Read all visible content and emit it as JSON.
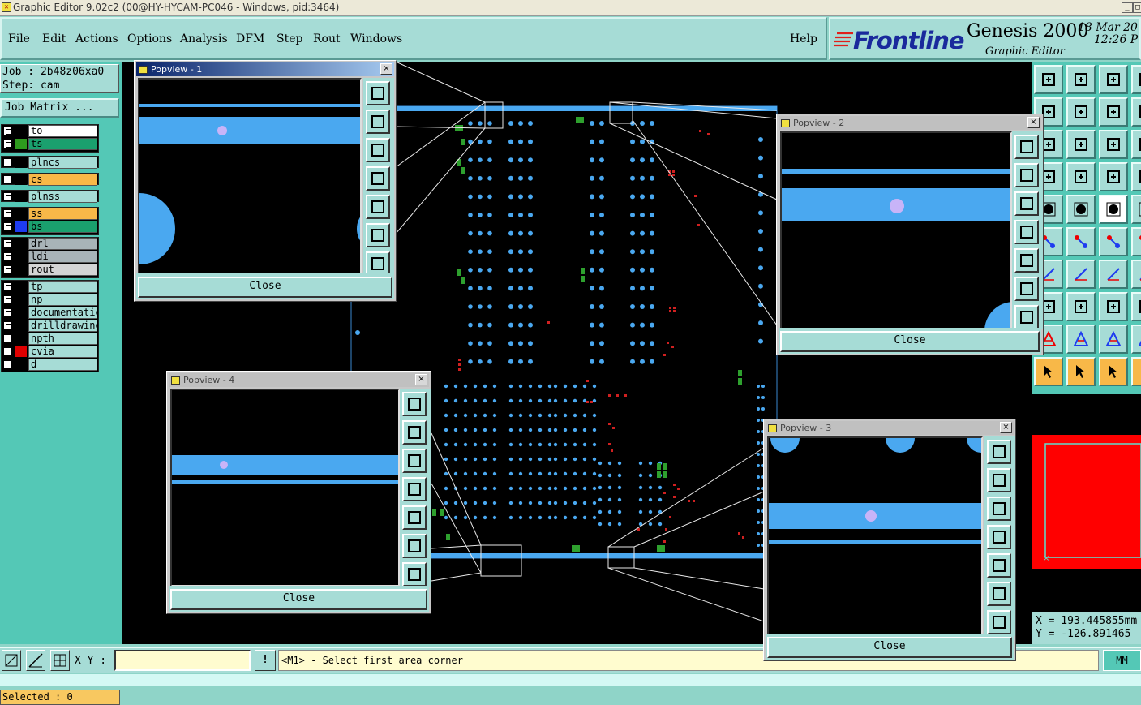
{
  "window": {
    "title": "Graphic Editor 9.02c2 (00@HY-HYCAM-PC046 - Windows, pid:3464)",
    "min": "_",
    "max": "□"
  },
  "menu": {
    "items": [
      "File",
      "Edit",
      "Actions",
      "Options",
      "Analysis",
      "DFM",
      "Step",
      "Rout",
      "Windows"
    ],
    "help": "Help"
  },
  "brand": {
    "logo": "Frontline",
    "product": "Genesis 2000",
    "subtitle": "Graphic Editor",
    "date": "18 Mar 20",
    "time": "12:26 P"
  },
  "job": {
    "job_line": "Job : 2b48z06xa0",
    "step_line": "Step: cam",
    "matrix_button": "Job Matrix ..."
  },
  "layers": [
    {
      "name": "to",
      "color": "#000000",
      "bg": "#ffffff"
    },
    {
      "name": "ts",
      "color": "#2e9a1e",
      "bg": "#1aa06e"
    },
    {
      "name": "plncs",
      "color": "#000000",
      "bg": "#a6dcd6"
    },
    {
      "name": "cs",
      "color": "#000000",
      "bg": "#f8b848"
    },
    {
      "name": "plnss",
      "color": "#000000",
      "bg": "#a6dcd6"
    },
    {
      "name": "ss",
      "color": "#000000",
      "bg": "#f8b848"
    },
    {
      "name": "bs",
      "color": "#1e3cf0",
      "bg": "#1aa06e"
    },
    {
      "name": "drl",
      "color": "#000000",
      "bg": "#a8b4b8"
    },
    {
      "name": "ldi",
      "color": "#000000",
      "bg": "#a8b4b8"
    },
    {
      "name": "rout",
      "color": "#000000",
      "bg": "#d4d4d4"
    },
    {
      "name": "tp",
      "color": "#000000",
      "bg": "#a6dcd6"
    },
    {
      "name": "np",
      "color": "#000000",
      "bg": "#a6dcd6"
    },
    {
      "name": "documentation",
      "color": "#000000",
      "bg": "#a6dcd6"
    },
    {
      "name": "drilldrawing",
      "color": "#000000",
      "bg": "#a6dcd6"
    },
    {
      "name": "npth",
      "color": "#000000",
      "bg": "#a6dcd6"
    },
    {
      "name": "cvia",
      "color": "#e00000",
      "bg": "#a6dcd6"
    },
    {
      "name": "d",
      "color": "#000000",
      "bg": "#a6dcd6"
    }
  ],
  "selected": "Selected : 0",
  "popups": [
    {
      "title": "Popview - 1",
      "close": "Close",
      "x": "×"
    },
    {
      "title": "Popview - 2",
      "close": "Close",
      "x": "×"
    },
    {
      "title": "Popview - 3",
      "close": "Close",
      "x": "×"
    },
    {
      "title": "Popview - 4",
      "close": "Close",
      "x": "×"
    }
  ],
  "coords": {
    "x": "X = 193.445855mm",
    "y": "Y = -126.891465"
  },
  "status": {
    "xy_label": "X Y :",
    "xy_value": "",
    "bang": "!",
    "prompt": "<M1> - Select first area corner",
    "units": "MM"
  },
  "colors": {
    "pad_blue": "#4aa8f0",
    "via_lilac": "#c8b4f8",
    "accent_teal": "#a6dcd6",
    "panel_green": "#54c8b6",
    "warn_red": "#e00000"
  }
}
